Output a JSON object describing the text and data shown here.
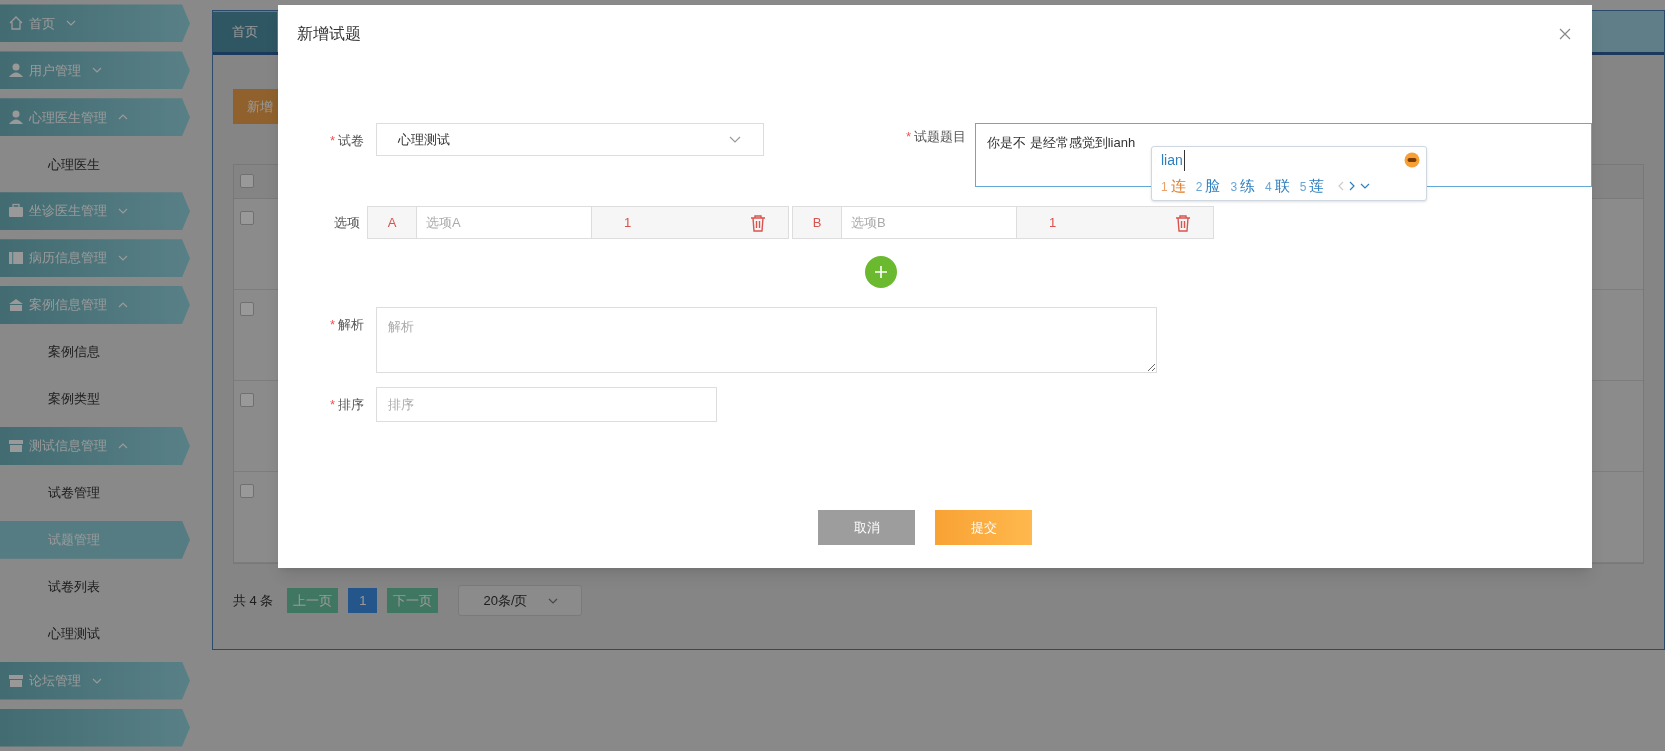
{
  "sidebar": {
    "items": [
      {
        "label": "首页",
        "expanded": false
      },
      {
        "label": "用户管理",
        "expanded": false
      },
      {
        "label": "心理医生管理",
        "expanded": true,
        "children": [
          {
            "label": "心理医生",
            "selected": false
          }
        ]
      },
      {
        "label": "坐诊医生管理",
        "expanded": false
      },
      {
        "label": "病历信息管理",
        "expanded": false
      },
      {
        "label": "案例信息管理",
        "expanded": true,
        "children": [
          {
            "label": "案例信息",
            "selected": false
          },
          {
            "label": "案例类型",
            "selected": false
          }
        ]
      },
      {
        "label": "测试信息管理",
        "expanded": true,
        "children": [
          {
            "label": "试卷管理",
            "selected": false
          },
          {
            "label": "试题管理",
            "selected": true
          },
          {
            "label": "试卷列表",
            "selected": false
          },
          {
            "label": "心理测试",
            "selected": false
          }
        ]
      },
      {
        "label": "论坛管理",
        "expanded": false
      }
    ]
  },
  "main": {
    "tab": "首页",
    "add_button": "新增",
    "table": {
      "header_checked": false,
      "rows": [
        {
          "checked": false
        },
        {
          "checked": false
        },
        {
          "checked": false
        },
        {
          "checked": false
        }
      ]
    },
    "pagination": {
      "total": "共 4 条",
      "prev": "上一页",
      "pages": [
        {
          "label": "1",
          "selected": true
        }
      ],
      "next": "下一页",
      "page_size": "20条/页"
    }
  },
  "dialog": {
    "title": "新增试题",
    "paper": {
      "required_mark": "*",
      "label": "试卷",
      "value": "心理测试"
    },
    "question": {
      "required_mark": "*",
      "label": "试题题目",
      "value": "你是不 是经常感觉到lianh",
      "focused": true
    },
    "options": {
      "label": "选项",
      "items": [
        {
          "letter": "A",
          "placeholder": "选项A",
          "score": "1"
        },
        {
          "letter": "B",
          "placeholder": "选项B",
          "score": "1"
        }
      ]
    },
    "analysis": {
      "required_mark": "*",
      "label": "解析",
      "placeholder": "解析"
    },
    "order": {
      "required_mark": "*",
      "label": "排序",
      "placeholder": "排序"
    },
    "buttons": [
      {
        "label": "取消",
        "kind": "cancel"
      },
      {
        "label": "提交",
        "kind": "submit"
      }
    ]
  },
  "ime": {
    "composition": "lian",
    "candidates": [
      {
        "number": "1",
        "text": "连",
        "selected": true
      },
      {
        "number": "2",
        "text": "脸",
        "selected": false
      },
      {
        "number": "3",
        "text": "练",
        "selected": false
      },
      {
        "number": "4",
        "text": "联",
        "selected": false
      },
      {
        "number": "5",
        "text": "莲",
        "selected": false
      }
    ]
  }
}
